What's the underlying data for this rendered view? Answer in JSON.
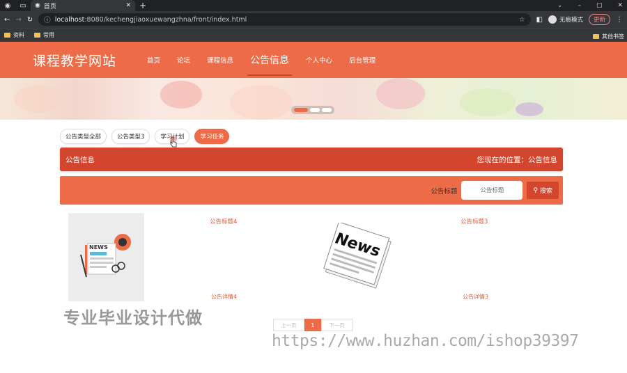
{
  "browser": {
    "tab_title": "首页",
    "url_host": "localhost",
    "url_rest": ":8080/kechengjiaoxuewangzhna/front/index.html",
    "profile_label": "无痕模式",
    "update_label": "更新",
    "bookmarks": [
      "资料",
      "常用"
    ],
    "bookmarks_right": "其他书签"
  },
  "site": {
    "logo": "课程教学网站",
    "nav": [
      "首页",
      "论坛",
      "课程信息",
      "公告信息",
      "个人中心",
      "后台管理"
    ],
    "active_nav": "公告信息"
  },
  "filters": [
    "公告类型全部",
    "公告类型3",
    "学习计划",
    "学习任务"
  ],
  "active_filter": "学习任务",
  "section": {
    "title": "公告信息",
    "breadcrumb": "您现在的位置：公告信息"
  },
  "search": {
    "label": "公告标题",
    "placeholder": "公告标题",
    "button": "搜索"
  },
  "items": [
    {
      "title": "公告标题4",
      "detail": "公告详情4",
      "image": "news-clipboard-icon"
    },
    {
      "title": "公告标题3",
      "detail": "公告详情3",
      "image": "news-newspaper-icon"
    }
  ],
  "pagination": {
    "prev": "上一页",
    "current": "1",
    "next": "下一页"
  },
  "watermarks": {
    "text1": "专业毕业设计代做",
    "text2": "https://www.huzhan.com/ishop39397"
  },
  "colors": {
    "primary": "#ee6b47",
    "dark": "#d4452e"
  }
}
